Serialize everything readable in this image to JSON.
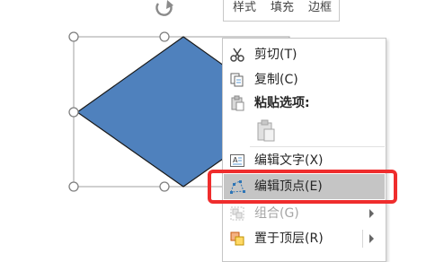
{
  "mini_toolbar": {
    "tabs": [
      "样式",
      "填充",
      "边框"
    ]
  },
  "shape": {
    "fill_color": "#4f81bd",
    "outline_color": "#1f1f1f",
    "type": "diamond"
  },
  "context_menu": {
    "items": [
      {
        "label": "剪切(T)",
        "icon": "scissors-icon",
        "enabled": true
      },
      {
        "label": "复制(C)",
        "icon": "copy-icon",
        "enabled": true
      },
      {
        "label": "粘贴选项:",
        "icon": "paste-icon",
        "enabled": true,
        "heading": true
      },
      {
        "label": "编辑文字(X)",
        "icon": "edit-text-icon",
        "enabled": true
      },
      {
        "label": "编辑顶点(E)",
        "icon": "edit-points-icon",
        "enabled": true,
        "highlighted": true
      },
      {
        "label": "组合(G)",
        "icon": "group-icon",
        "enabled": false,
        "submenu": true
      },
      {
        "label": "置于顶层(R)",
        "icon": "bring-to-front-icon",
        "enabled": true,
        "submenu": true
      }
    ],
    "paste_option_icon": "paste-keep-format-icon"
  },
  "colors": {
    "highlight": "#c5c5c5",
    "annotation_red": "#ef2d2d",
    "handle_border": "#7f7f7f"
  }
}
